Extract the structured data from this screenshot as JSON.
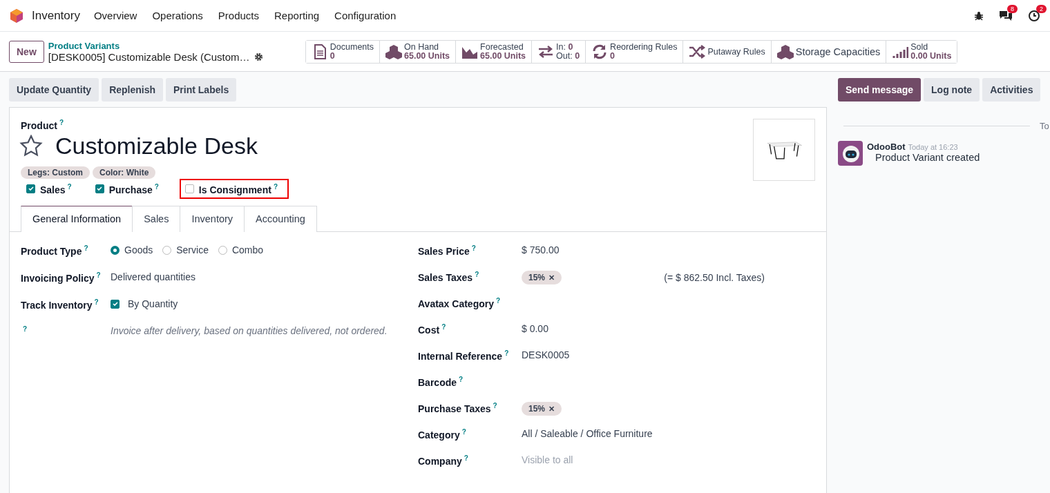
{
  "navbar": {
    "app_name": "Inventory",
    "menu": [
      "Overview",
      "Operations",
      "Products",
      "Reporting",
      "Configuration"
    ],
    "messages_badge": "8",
    "activities_badge": "2"
  },
  "control_panel": {
    "new_button": "New",
    "breadcrumb": "Product Variants",
    "record_title": "[DESK0005] Customizable Desk (Custom…",
    "smart_buttons": [
      {
        "label": "Documents",
        "value": "0"
      },
      {
        "label": "On Hand",
        "value": "65.00 Units"
      },
      {
        "label": "Forecasted",
        "value": "65.00 Units"
      },
      {
        "kind": "inout",
        "label": "In:",
        "value": "0",
        "label_2": "Out:",
        "value_2": "0"
      },
      {
        "label": "Reordering Rules",
        "value": "0"
      },
      {
        "kind": "plain",
        "label": "Putaway Rules"
      },
      {
        "kind": "large",
        "label": "Storage Capacities"
      },
      {
        "label": "Sold",
        "value": "0.00 Units"
      }
    ]
  },
  "action_buttons": [
    "Update Quantity",
    "Replenish",
    "Print Labels"
  ],
  "chatter_buttons": [
    {
      "label": "Send message",
      "kind": "primary"
    },
    {
      "label": "Log note",
      "kind": "secondary"
    },
    {
      "label": "Activities",
      "kind": "secondary"
    }
  ],
  "form": {
    "product_label": "Product",
    "product_help": "?",
    "favorite": false,
    "title": "Customizable Desk",
    "tags": [
      "Legs: Custom",
      "Color: White"
    ],
    "options": [
      {
        "label": "Sales",
        "help": "?",
        "checked": true,
        "highlighted": false
      },
      {
        "label": "Purchase",
        "help": "?",
        "checked": true,
        "highlighted": false
      },
      {
        "label": "Is Consignment",
        "help": "?",
        "checked": false,
        "highlighted": true
      }
    ],
    "tabs": [
      {
        "label": "General Information",
        "selected": true
      },
      {
        "label": "Sales",
        "selected": false
      },
      {
        "label": "Inventory",
        "selected": false
      },
      {
        "label": "Accounting",
        "selected": false
      }
    ],
    "left_fields": [
      {
        "kind": "radio",
        "label": "Product Type",
        "help": "?",
        "options": [
          {
            "label": "Goods",
            "selected": true
          },
          {
            "label": "Service",
            "selected": false
          },
          {
            "label": "Combo",
            "selected": false
          }
        ]
      },
      {
        "kind": "text",
        "label": "Invoicing Policy",
        "help": "?",
        "value": "Delivered quantities"
      },
      {
        "kind": "checkbox",
        "label": "Track Inventory",
        "help": "?",
        "value": "By Quantity",
        "checked": true
      },
      {
        "kind": "help",
        "help": "?",
        "value": "Invoice after delivery, based on quantities delivered, not ordered."
      }
    ],
    "right_fields": [
      {
        "kind": "text",
        "label": "Sales Price",
        "help": "?",
        "value": "$ 750.00"
      },
      {
        "kind": "tags",
        "label": "Sales Taxes",
        "help": "?",
        "tags": [
          {
            "label": "15%",
            "remove": "✕"
          }
        ],
        "note": "(= $ 862.50 Incl. Taxes)"
      },
      {
        "kind": "empty",
        "label": "Avatax Category",
        "help": "?"
      },
      {
        "kind": "text",
        "label": "Cost",
        "help": "?",
        "value": "$ 0.00"
      },
      {
        "kind": "text",
        "label": "Internal Reference",
        "help": "?",
        "value": "DESK0005"
      },
      {
        "kind": "empty",
        "label": "Barcode",
        "help": "?"
      },
      {
        "kind": "tags",
        "label": "Purchase Taxes",
        "help": "?",
        "tags": [
          {
            "label": "15%",
            "remove": "✕"
          }
        ]
      },
      {
        "kind": "text",
        "label": "Category",
        "help": "?",
        "value": "All / Saleable / Office Furniture"
      },
      {
        "kind": "muted",
        "label": "Company",
        "help": "?",
        "placeholder": "Visible to all"
      }
    ]
  },
  "chatter": {
    "date_separator": "To",
    "author": "OdooBot",
    "time": "Today at 16:23",
    "body": "Product Variant created"
  }
}
